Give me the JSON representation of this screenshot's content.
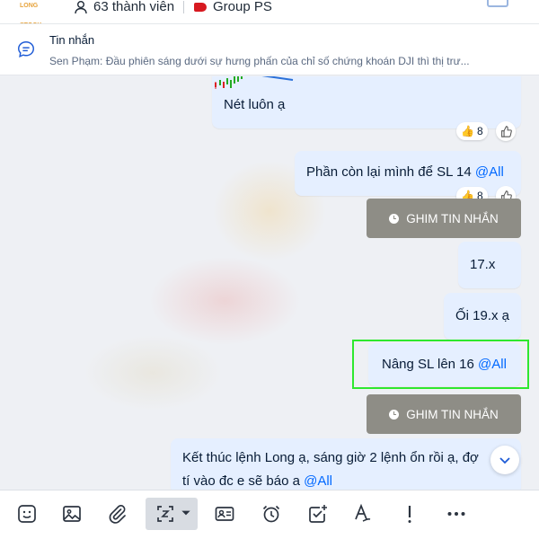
{
  "header": {
    "logo_text": "LONG STOCK",
    "members": "63 thành viên",
    "group": "Group PS"
  },
  "pinned": {
    "title": "Tin nhắn",
    "preview": "Sen Phạm: Đầu phiên sáng dưới sự hưng phấn của chỉ số chứng khoán DJI thì thị trư..."
  },
  "messages": [
    {
      "text": "Nét luôn ạ",
      "reaction_count": "8"
    },
    {
      "text": "Phần còn lại mình để SL 14 ",
      "mention": "@All",
      "reaction_count": "8"
    },
    {
      "pin_label": "GHIM TIN NHẮN"
    },
    {
      "text": "17.x"
    },
    {
      "text": "Ối 19.x ạ"
    },
    {
      "text": "Nâng SL lên 16 ",
      "mention": "@All"
    },
    {
      "pin_label": "GHIM TIN NHẮN"
    },
    {
      "text": "Kết thúc lệnh Long ạ, sáng giờ 2 lệnh ổn rồi ạ, đợ",
      "text2": "tí vào đc e sẽ báo a ",
      "mention": "@All"
    }
  ],
  "reaction_emoji": "👍",
  "toolbar": {
    "icons": [
      "sticker-icon",
      "image-icon",
      "attachment-icon",
      "screenshot-icon",
      "contact-card-icon",
      "reminder-icon",
      "task-icon",
      "format-text-icon",
      "important-icon",
      "more-icon"
    ]
  },
  "colors": {
    "accent": "#0068ff",
    "bubble": "#e5efff",
    "pin_button": "#8e8d86",
    "highlight": "#2ee82e"
  }
}
